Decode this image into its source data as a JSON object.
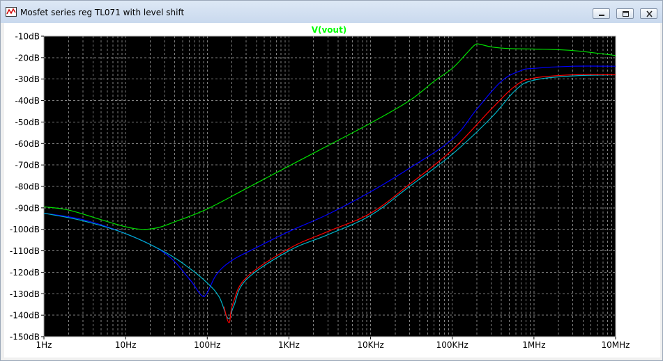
{
  "window": {
    "title": "Mosfet series reg TL071 with level shift",
    "icon": "waveform-plot-icon",
    "controls": [
      "minimize-icon",
      "restore-icon",
      "close-icon"
    ]
  },
  "chart_data": {
    "type": "line",
    "title": "V(vout)",
    "xscale": "log",
    "xlim": [
      1,
      10000000
    ],
    "ylim": [
      -150,
      -10
    ],
    "x_tick_labels": [
      "1Hz",
      "10Hz",
      "100Hz",
      "1KHz",
      "10KHz",
      "100KHz",
      "1MHz",
      "10MHz"
    ],
    "y_tick_labels": [
      "-10dB",
      "-20dB",
      "-30dB",
      "-40dB",
      "-50dB",
      "-60dB",
      "-70dB",
      "-80dB",
      "-90dB",
      "-100dB",
      "-110dB",
      "-120dB",
      "-130dB",
      "-140dB",
      "-150dB"
    ],
    "grid": true,
    "background": "#000000",
    "grid_color": "#808080",
    "axis_text_color": "#000000",
    "title_color": "#00ff00",
    "series": [
      {
        "color": "#00e000",
        "points": [
          [
            1,
            -89.5
          ],
          [
            2,
            -91
          ],
          [
            5,
            -95.5
          ],
          [
            10,
            -98.8
          ],
          [
            16,
            -100
          ],
          [
            25,
            -99.2
          ],
          [
            40,
            -96.5
          ],
          [
            100,
            -90.5
          ],
          [
            300,
            -81
          ],
          [
            1000,
            -70.5
          ],
          [
            3000,
            -61
          ],
          [
            10000,
            -50.5
          ],
          [
            30000,
            -40
          ],
          [
            60000,
            -31
          ],
          [
            100000,
            -25
          ],
          [
            150000,
            -18
          ],
          [
            190000,
            -14
          ],
          [
            220000,
            -13.8
          ],
          [
            300000,
            -15
          ],
          [
            500000,
            -15.8
          ],
          [
            1000000,
            -16
          ],
          [
            3000000,
            -16.7
          ],
          [
            10000000,
            -19
          ]
        ]
      },
      {
        "color": "#0000ff",
        "points": [
          [
            1,
            -92.5
          ],
          [
            3,
            -95.5
          ],
          [
            10,
            -102
          ],
          [
            30,
            -111
          ],
          [
            60,
            -123
          ],
          [
            85,
            -130.8
          ],
          [
            100,
            -129.5
          ],
          [
            130,
            -121
          ],
          [
            200,
            -114.5
          ],
          [
            400,
            -108.5
          ],
          [
            1000,
            -101
          ],
          [
            3000,
            -93
          ],
          [
            10000,
            -82.5
          ],
          [
            30000,
            -71.5
          ],
          [
            100000,
            -58
          ],
          [
            200000,
            -44
          ],
          [
            400000,
            -31
          ],
          [
            700000,
            -26
          ],
          [
            1000000,
            -25
          ],
          [
            3000000,
            -24
          ],
          [
            10000000,
            -24
          ]
        ]
      },
      {
        "color": "#00b4c8",
        "points": [
          [
            1,
            -92.5
          ],
          [
            3,
            -96
          ],
          [
            10,
            -102
          ],
          [
            30,
            -110.5
          ],
          [
            60,
            -118
          ],
          [
            100,
            -125
          ],
          [
            140,
            -131.5
          ],
          [
            180,
            -141.5
          ],
          [
            210,
            -136
          ],
          [
            300,
            -123.5
          ],
          [
            1000,
            -110
          ],
          [
            3000,
            -102.5
          ],
          [
            10000,
            -93.5
          ],
          [
            30000,
            -80
          ],
          [
            100000,
            -65
          ],
          [
            300000,
            -48
          ],
          [
            600000,
            -35
          ],
          [
            1000000,
            -30.5
          ],
          [
            3000000,
            -28.5
          ],
          [
            10000000,
            -28
          ]
        ]
      },
      {
        "color": "#ff0000",
        "points": [
          [
            160,
            -136
          ],
          [
            185,
            -143.5
          ],
          [
            205,
            -135
          ],
          [
            300,
            -122.5
          ],
          [
            1000,
            -109
          ],
          [
            3000,
            -101
          ],
          [
            10000,
            -92.5
          ],
          [
            30000,
            -79
          ],
          [
            100000,
            -63
          ],
          [
            300000,
            -44
          ],
          [
            600000,
            -33
          ],
          [
            1000000,
            -29.5
          ],
          [
            3000000,
            -28
          ],
          [
            10000000,
            -28
          ]
        ]
      }
    ]
  }
}
